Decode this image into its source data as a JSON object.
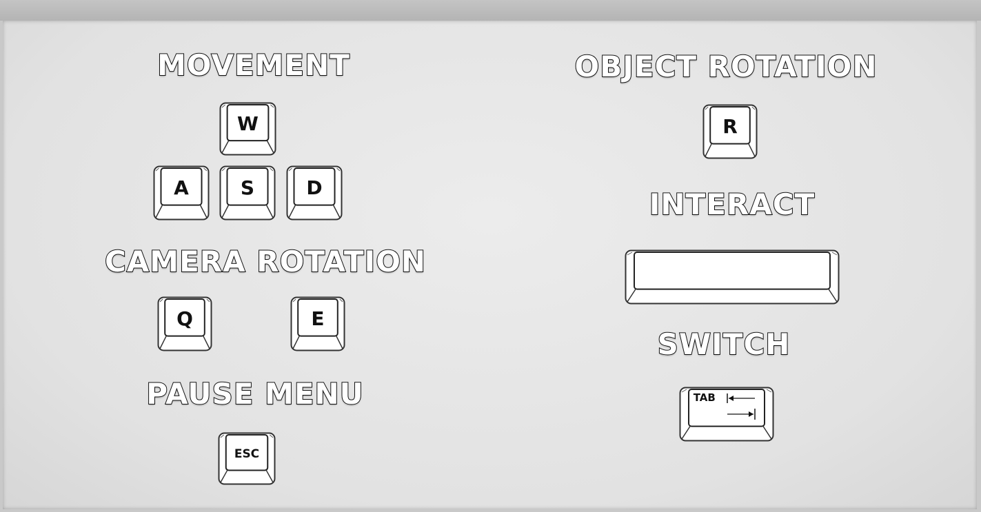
{
  "sections": {
    "movement": {
      "title": "MOVEMENT",
      "keys": [
        "W",
        "A",
        "S",
        "D"
      ]
    },
    "camera_rotation": {
      "title": "CAMERA ROTATION",
      "keys": [
        "Q",
        "E"
      ]
    },
    "pause_menu": {
      "title": "PAUSE MENU",
      "keys": [
        "ESC"
      ]
    },
    "object_rotation": {
      "title": "OBJECT ROTATION",
      "keys": [
        "R"
      ]
    },
    "interact": {
      "title": "INTERACT",
      "key_icon": "spacebar-key"
    },
    "switch": {
      "title": "SWITCH",
      "keys": [
        "TAB"
      ],
      "key_icon": "tab-arrows-icon"
    }
  }
}
